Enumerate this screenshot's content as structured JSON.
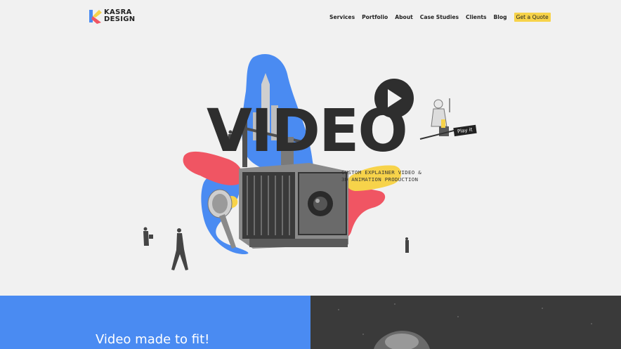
{
  "brand": {
    "line1": "KASRA",
    "line2": "DESIGN"
  },
  "nav": {
    "items": [
      "Services",
      "Portfolio",
      "About",
      "Case Studies",
      "Clients",
      "Blog"
    ],
    "cta": "Get a Quote"
  },
  "hero": {
    "title": "VIDEO",
    "subtitle_line1": "CUSTOM EXPLAINER VIDEO &",
    "subtitle_line2": "3D ANIMATION PRODUCTION",
    "sign": "Play it"
  },
  "section": {
    "title": "Video made to fit!"
  },
  "colors": {
    "blue": "#4a8bf2",
    "red": "#f05563",
    "yellow": "#f7d34a",
    "dark": "#2e2e2e"
  }
}
